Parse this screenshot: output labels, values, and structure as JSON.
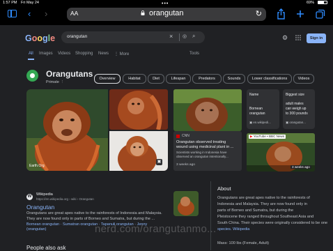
{
  "status": {
    "time": "1:57 PM",
    "date": "Fri May 24",
    "battery": "69%"
  },
  "browser": {
    "text_size_label": "AA",
    "url": "orangutan",
    "icons": [
      "sidebar-icon",
      "back-icon",
      "forward-icon",
      "share-icon",
      "new-tab-icon",
      "tabs-icon",
      "reload-icon",
      "lock-icon"
    ]
  },
  "google": {
    "logo": [
      "G",
      "o",
      "o",
      "g",
      "l",
      "e"
    ],
    "logo_colors": [
      "#8ab4f8",
      "#f28b82",
      "#fdd663",
      "#8ab4f8",
      "#81c995",
      "#f28b82"
    ],
    "query": "orangutan",
    "sign_in": "Sign in",
    "tabs": [
      "All",
      "Images",
      "Videos",
      "Shopping",
      "News",
      "⋮ More"
    ],
    "tools": "Tools"
  },
  "knowledge": {
    "title": "Orangutans",
    "subtitle": "Primate",
    "chips": [
      "Overview",
      "Habitat",
      "Diet",
      "Lifespan",
      "Predators",
      "Sounds",
      "Lower classifications",
      "Videos"
    ],
    "image_credit": "Earth.Org",
    "cnn": {
      "source": "CNN",
      "headline_1": "Orangutan observed treating",
      "headline_2": "wound using medicinal plant in ...",
      "body_1": "Scientists working in Indonesia have",
      "body_2": "observed an orangutan intentionally...",
      "age": "3 weeks ago"
    },
    "name_card": {
      "label": "Name",
      "value_1": "Bornean",
      "value_2": "orangutan",
      "source": "en.wikipedi..."
    },
    "size_card": {
      "label": "Biggest size",
      "value_1": "adult males",
      "value_2": "can weigh up",
      "value_3": "to 300 pounds",
      "source": "orangutan..."
    },
    "yt": {
      "source": "YouTube • BBC News",
      "age": "3 weeks ago"
    }
  },
  "result": {
    "site": "Wikipedia",
    "url": "https://en.wikipedia.org › wiki › Orangutan",
    "title": "Orangutan",
    "snippet_1": "Orangutans are great apes native to the rainforests of Indonesia and Malaysia.",
    "snippet_2": "They are now found only in parts of Borneo and Sumatra, but during the ...",
    "links": "Bornean orangutan · Sumatran orangutan · Tapanuli orangutan · Jenny",
    "links_2": "(orangutan)"
  },
  "people_also_ask": "People also ask",
  "about": {
    "title": "About",
    "lines": [
      "Orangutans are great apes native to the rainforests of",
      "Indonesia and Malaysia. They are now found only in",
      "parts of Borneo and Sumatra, but during the",
      "Pleistocene they ranged throughout Southeast Asia and",
      "South China. Their species were originally considered to be one",
      "species. Wikipedia"
    ],
    "mass": "Mass: 100 lbs (Female, Adult)"
  },
  "watermark": "nerd.com/orangutanmo..."
}
